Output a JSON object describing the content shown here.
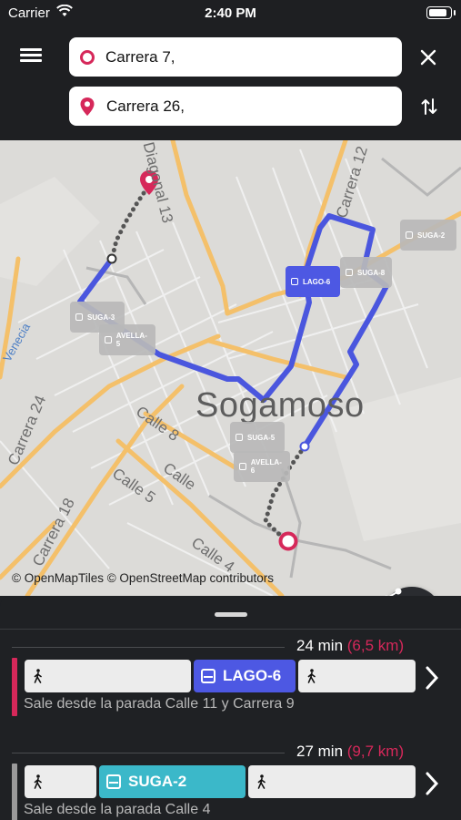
{
  "status": {
    "carrier": "Carrier",
    "time": "2:40 PM",
    "battery_level": 0.9
  },
  "header": {
    "origin_value": "Carrera 7,",
    "destination_value": "Carrera 26,",
    "origin_icon": "origin-ring-icon",
    "destination_icon": "destination-pin-icon",
    "accent": "#d6285a"
  },
  "map": {
    "city": "Sogamoso",
    "streets": [
      "Diagonal 13",
      "Carrera 12",
      "Carrera 24",
      "Calle 8",
      "Calle 5",
      "Calle",
      "Carrera 18",
      "Calle 4",
      "Venecia"
    ],
    "stops": [
      "LAGO-6",
      "SUGA-2",
      "SUGA-3",
      "AVELLA-5",
      "SUGA-8",
      "SUGA-5",
      "AVELLA-6"
    ],
    "active_stop": "LAGO-6",
    "attribution": "© OpenMapTiles © OpenStreetMap contributors",
    "route_color": "#4a56de"
  },
  "routes": [
    {
      "duration": "24 min",
      "distance": "(6,5 km)",
      "distance_color": "#d6285a",
      "bar_color": "#d6285a",
      "bus_line": "LAGO-6",
      "bus_color": "#4d58e3",
      "departure": "Sale desde la parada Calle 11 y Carrera 9"
    },
    {
      "duration": "27 min",
      "distance": "(9,7 km)",
      "distance_color": "#d6285a",
      "bar_color": "#9a9a9a",
      "bus_line": "SUGA-2",
      "bus_color": "#3bb8c9",
      "departure": "Sale desde la parada Calle 4"
    }
  ]
}
